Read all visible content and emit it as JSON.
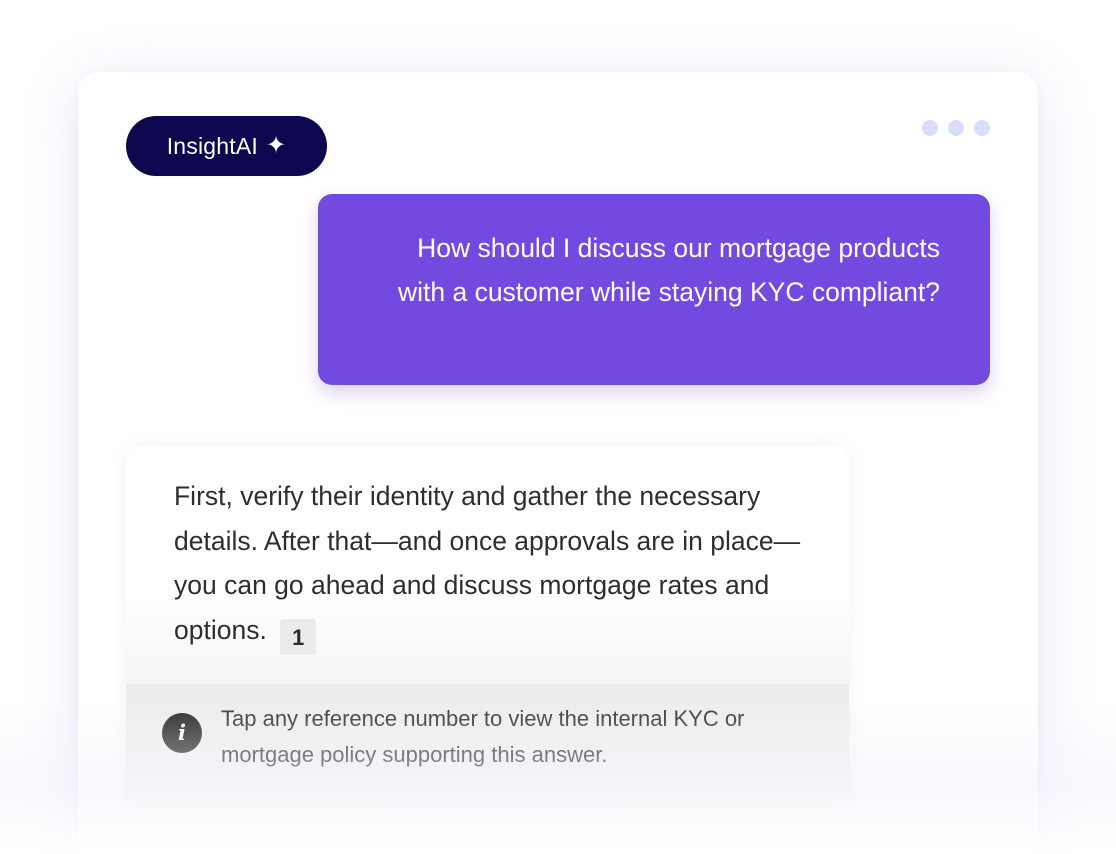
{
  "header": {
    "brand_label": "InsightAI",
    "brand_icon": "sparkle-icon",
    "more_icon": "more-options-icon"
  },
  "conversation": {
    "user_message": "How should I discuss our mortgage products with a customer while staying KYC compliant?",
    "assistant_message": "First, verify their identity and gather the necessary details. After that—and once approvals are in place—you can go ahead and discuss mortgage rates and options.",
    "reference_number": "1",
    "info_note": "Tap any reference number to view the internal KYC or mortgage policy supporting this answer.",
    "info_icon": "info-icon"
  },
  "colors": {
    "brand_pill": "#0d0750",
    "user_bubble": "#724ae0",
    "dots": "#d9dcfb",
    "info_icon_bg": "#2e2e2e",
    "reference_badge_bg": "#ebebeb"
  }
}
